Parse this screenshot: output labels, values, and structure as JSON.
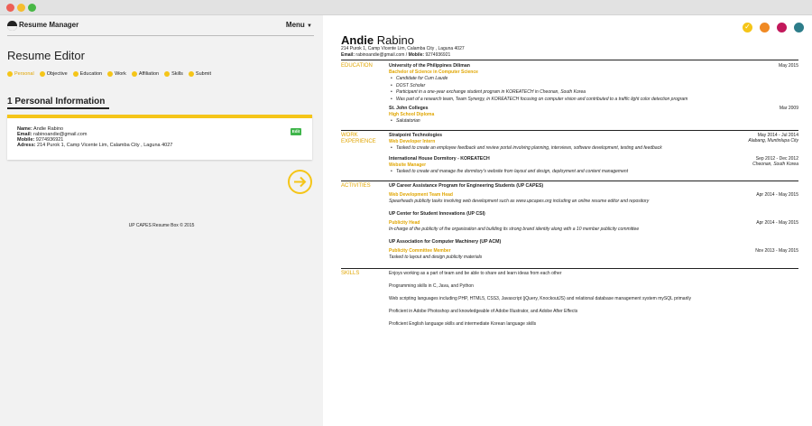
{
  "app": {
    "title": "Resume Manager",
    "menu_label": "Menu"
  },
  "editor": {
    "title": "Resume Editor",
    "steps": [
      {
        "label": "Personal"
      },
      {
        "label": "Objective"
      },
      {
        "label": "Education"
      },
      {
        "label": "Work"
      },
      {
        "label": "Affiliation"
      },
      {
        "label": "Skills"
      },
      {
        "label": "Submit"
      }
    ],
    "active_step": "Personal",
    "section_title": "1 Personal Information",
    "card": {
      "name_label": "Name:",
      "name": "Andie Rabino",
      "email_label": "Email:",
      "email": "rabinoandie@gmail.com",
      "mobile_label": "Mobile:",
      "mobile": "9274936921",
      "address_label": "Adress:",
      "address": "214 Purok 1, Camp Vicente Lim, Calamba City , Laguna 4027",
      "edit_label": "Edit"
    },
    "footer": "UP CAPES Resume Box © 2015"
  },
  "themes": {
    "colors": [
      "#f5c518",
      "#f08a24",
      "#c2185b",
      "#2d7d8a"
    ],
    "selected_index": 0
  },
  "resume": {
    "first_name": "Andie",
    "last_name": "Rabino",
    "address": "214 Purok 1, Camp Vicente Lim, Calamba City , Laguna 4027",
    "email_label": "Email:",
    "email": "rabinoandie@gmail.com",
    "mobile_label": "Mobile:",
    "mobile": "9274936921",
    "education_label": "EDUCATION",
    "education": [
      {
        "org": "University of the Philippines Diliman",
        "role": "Bachelor of Science in Computer Science",
        "date": "May 2015",
        "bullets": [
          "Candidate for Cum Laude",
          "DOST Scholar",
          "Participant in a one-year exchange student program in KOREATECH in Cheonan, South Korea",
          "Was part of a research team, Team Synergy, in KOREATECH focusing on computer vision and contributed to a traffic light color detection program"
        ]
      },
      {
        "org": "St. John Colleges",
        "role": "High School Diploma",
        "date": "Mar 2009",
        "bullets": [
          "Salutatorian"
        ]
      }
    ],
    "work_label": "WORK EXPERIENCE",
    "work": [
      {
        "org": "Stratpoint Technologies",
        "role": "Web Developer Intern",
        "date": "May 2014 - Jul 2014",
        "location": "Alabang, Muntinlupa City",
        "bullets": [
          "Tasked to create an employee feedback and review portal involving planning, interviews, software development, testing and feedback"
        ]
      },
      {
        "org": "International House Dormitory - KOREATECH",
        "role": "Website Manager",
        "date": "Sep 2012 - Dec 2012",
        "location": "Cheonan, South Korea",
        "bullets": [
          "Tasked to create and manage the dormitory's website from layout and design, deployment and content management"
        ]
      }
    ],
    "activities_label": "ACTIVITIES",
    "activities": [
      {
        "org": "UP Career Assistance Program for Engineering Students (UP CAPES)",
        "role": "Web Development Team Head",
        "date": "Apr 2014 - May 2015",
        "desc": "Spearheads publicity tasks involving web development such as www.upcapes.org including an online resume editor and repository"
      },
      {
        "org": "UP Center for Student Innovations (UP CSI)",
        "role": "Publicity Head",
        "date": "Apr 2014 - May 2015",
        "desc": "In-charge of the publicity of the organization and building its strong brand identity along with a 10 member publicity committee"
      },
      {
        "org": "UP Association for Computer Machinery (UP ACM)",
        "role": "Publicity Committee Member",
        "date": "Nov 2013 - May 2015",
        "desc": "Tasked to layout and design publicity materials"
      }
    ],
    "skills_label": "SKILLS",
    "skills": [
      "Enjoys working as a part of team and be able to share and learn ideas from each other",
      "Programming skills in C, Java, and Python",
      "Web scripting languages including PHP, HTML5, CSS3, Javascript (jQuery, KnockoutJS) and relational database management system mySQL primarily",
      "Proficient in Adobe Photoshop and knowledgeable of Adobe Illustrator, and Adobe After Effects",
      "Proficient English language skills and intermediate Korean language skills"
    ]
  }
}
